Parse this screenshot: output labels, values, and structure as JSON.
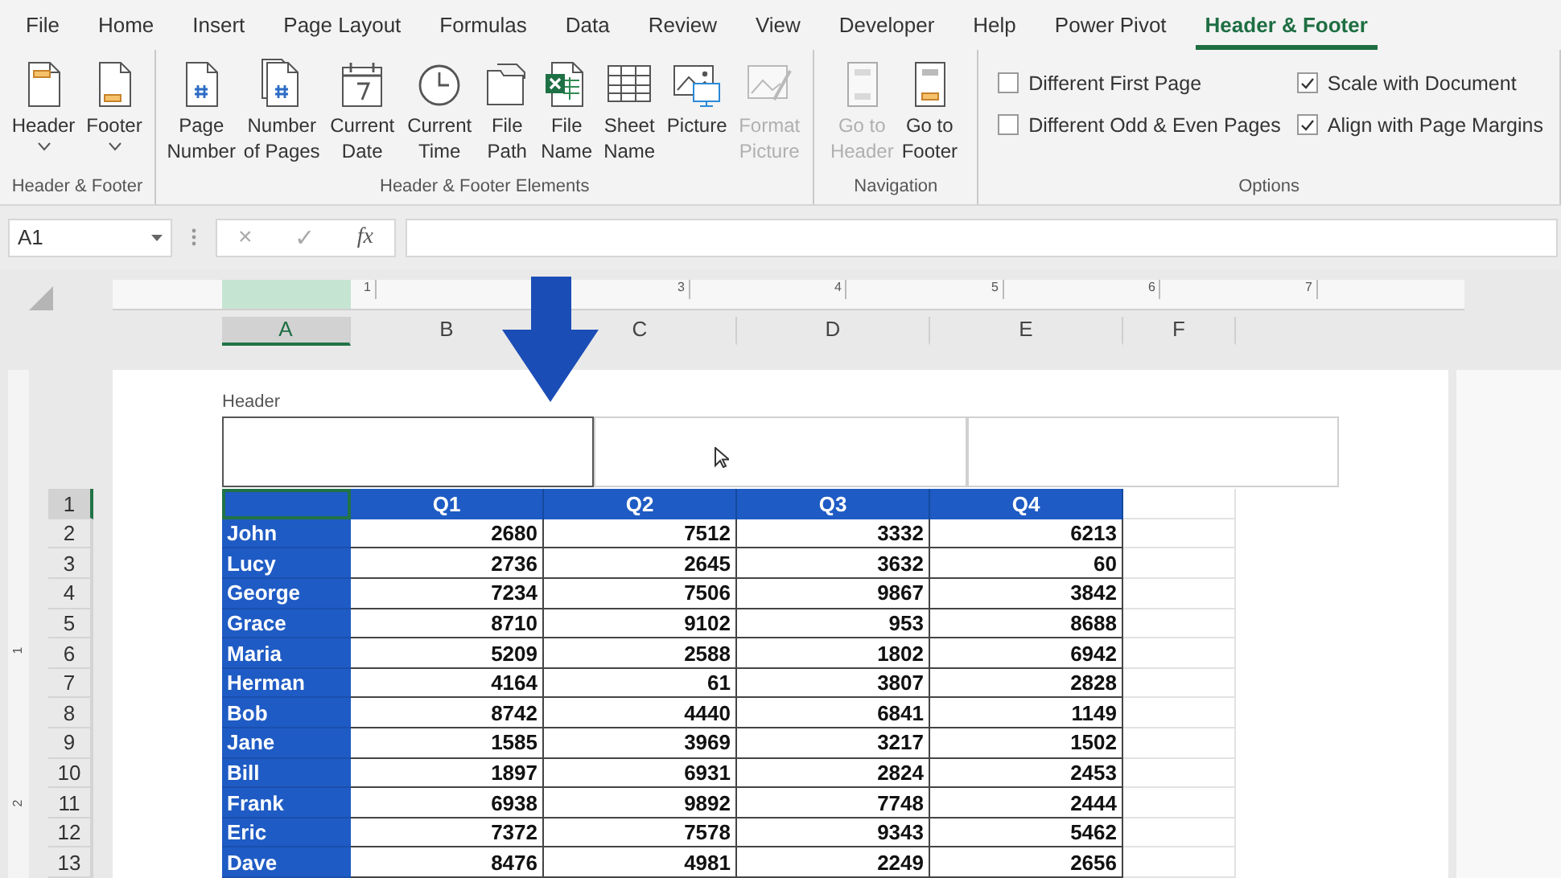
{
  "menu_tabs": [
    {
      "label": "File",
      "selected": false
    },
    {
      "label": "Home",
      "selected": false
    },
    {
      "label": "Insert",
      "selected": false
    },
    {
      "label": "Page Layout",
      "selected": false
    },
    {
      "label": "Formulas",
      "selected": false
    },
    {
      "label": "Data",
      "selected": false
    },
    {
      "label": "Review",
      "selected": false
    },
    {
      "label": "View",
      "selected": false
    },
    {
      "label": "Developer",
      "selected": false
    },
    {
      "label": "Help",
      "selected": false
    },
    {
      "label": "Power Pivot",
      "selected": false
    },
    {
      "label": "Header & Footer",
      "selected": true
    }
  ],
  "ribbon": {
    "groups": [
      {
        "label": "Header & Footer",
        "buttons": [
          {
            "label": "Header",
            "disabled": false,
            "dropdown": true
          },
          {
            "label": "Footer",
            "disabled": false,
            "dropdown": true
          }
        ]
      },
      {
        "label": "Header & Footer Elements",
        "buttons": [
          {
            "label": "Page Number",
            "disabled": false,
            "dropdown": false
          },
          {
            "label": "Number of Pages",
            "disabled": false,
            "dropdown": false
          },
          {
            "label": "Current Date",
            "disabled": false,
            "dropdown": false
          },
          {
            "label": "Current Time",
            "disabled": false,
            "dropdown": false
          },
          {
            "label": "File Path",
            "disabled": false,
            "dropdown": false
          },
          {
            "label": "File Name",
            "disabled": false,
            "dropdown": false
          },
          {
            "label": "Sheet Name",
            "disabled": false,
            "dropdown": false
          },
          {
            "label": "Picture",
            "disabled": false,
            "dropdown": false
          },
          {
            "label": "Format Picture",
            "disabled": true,
            "dropdown": false
          }
        ]
      },
      {
        "label": "Navigation",
        "buttons": [
          {
            "label": "Go to Header",
            "disabled": true,
            "dropdown": false
          },
          {
            "label": "Go to Footer",
            "disabled": false,
            "dropdown": false
          }
        ]
      }
    ],
    "options": {
      "label": "Options",
      "checkboxes": [
        {
          "label": "Different First Page",
          "checked": false
        },
        {
          "label": "Scale with Document",
          "checked": true
        },
        {
          "label": "Different Odd & Even Pages",
          "checked": false
        },
        {
          "label": "Align with Page Margins",
          "checked": true
        }
      ]
    }
  },
  "formula_bar": {
    "name_box": "A1",
    "cancel": "×",
    "enter": "✓",
    "function": "fx"
  },
  "ruler": [
    "1",
    "3",
    "4",
    "5",
    "6",
    "7"
  ],
  "vertical_ruler": [
    "1",
    "2"
  ],
  "columns": [
    {
      "label": "A",
      "selected": true
    },
    {
      "label": "B",
      "selected": false
    },
    {
      "label": "C",
      "selected": false
    },
    {
      "label": "D",
      "selected": false
    },
    {
      "label": "E",
      "selected": false
    },
    {
      "label": "F",
      "selected": false
    }
  ],
  "header_area": {
    "label": "Header",
    "sections": [
      {
        "selected": true
      },
      {
        "selected": false
      },
      {
        "selected": false
      }
    ]
  },
  "table": {
    "header": {
      "number": "1",
      "selected": true,
      "cells": [
        "Q1",
        "Q2",
        "Q3",
        "Q4"
      ]
    },
    "rows": [
      {
        "number": "2",
        "selected": false,
        "name": "John",
        "values": [
          "2680",
          "7512",
          "3332",
          "6213"
        ]
      },
      {
        "number": "3",
        "selected": false,
        "name": "Lucy",
        "values": [
          "2736",
          "2645",
          "3632",
          "60"
        ]
      },
      {
        "number": "4",
        "selected": false,
        "name": "George",
        "values": [
          "7234",
          "7506",
          "9867",
          "3842"
        ]
      },
      {
        "number": "5",
        "selected": false,
        "name": "Grace",
        "values": [
          "8710",
          "9102",
          "953",
          "8688"
        ]
      },
      {
        "number": "6",
        "selected": false,
        "name": "Maria",
        "values": [
          "5209",
          "2588",
          "1802",
          "6942"
        ]
      },
      {
        "number": "7",
        "selected": false,
        "name": "Herman",
        "values": [
          "4164",
          "61",
          "3807",
          "2828"
        ]
      },
      {
        "number": "8",
        "selected": false,
        "name": "Bob",
        "values": [
          "8742",
          "4440",
          "6841",
          "1149"
        ]
      },
      {
        "number": "9",
        "selected": false,
        "name": "Jane",
        "values": [
          "1585",
          "3969",
          "3217",
          "1502"
        ]
      },
      {
        "number": "10",
        "selected": false,
        "name": "Bill",
        "values": [
          "1897",
          "6931",
          "2824",
          "2453"
        ]
      },
      {
        "number": "11",
        "selected": false,
        "name": "Frank",
        "values": [
          "6938",
          "9892",
          "7748",
          "2444"
        ]
      },
      {
        "number": "12",
        "selected": false,
        "name": "Eric",
        "values": [
          "7372",
          "7578",
          "9343",
          "5462"
        ]
      },
      {
        "number": "13",
        "selected": false,
        "name": "Dave",
        "values": [
          "8476",
          "4981",
          "2249",
          "2656"
        ]
      }
    ]
  }
}
